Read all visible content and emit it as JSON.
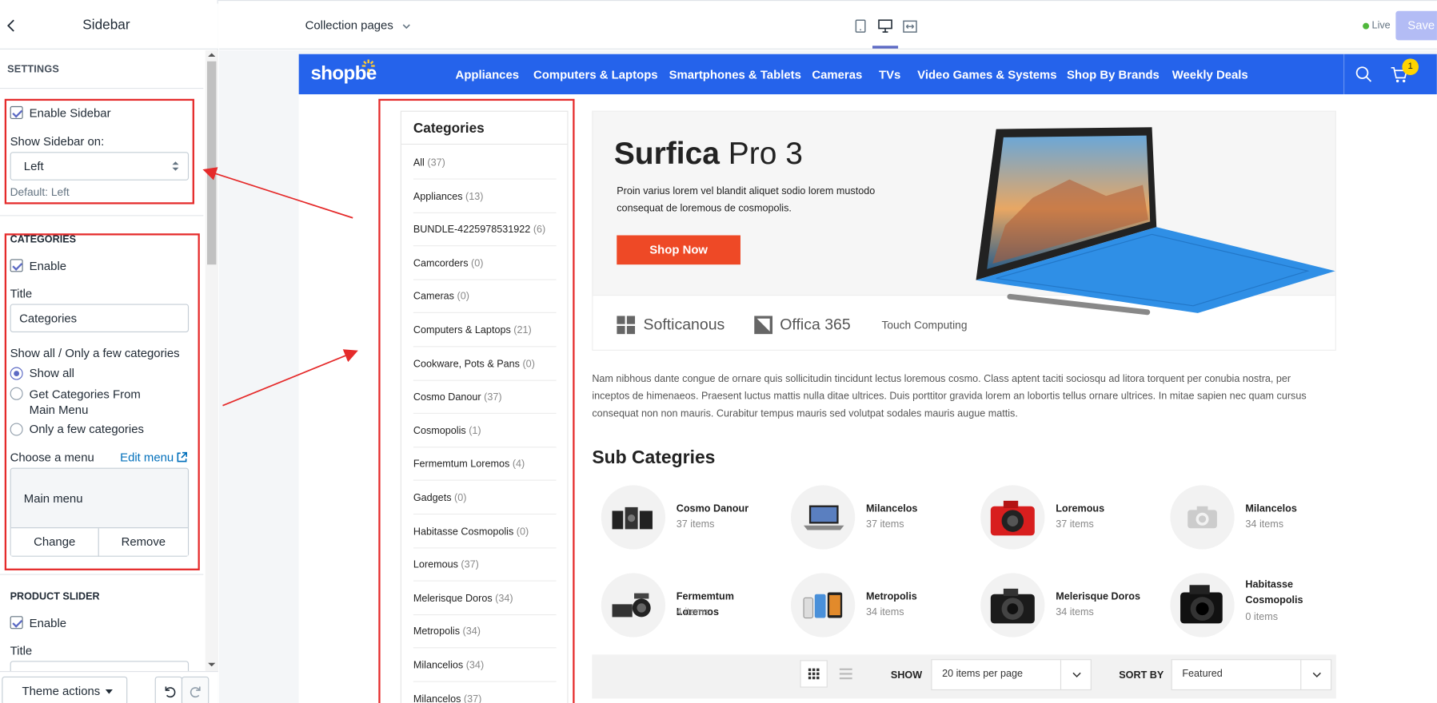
{
  "sidebar": {
    "title": "Sidebar",
    "settings_heading": "SETTINGS",
    "enable_sidebar_label": "Enable Sidebar",
    "show_on_label": "Show Sidebar on:",
    "show_on_value": "Left",
    "show_on_default": "Default: Left",
    "categories_heading": "CATEGORIES",
    "cat_enable_label": "Enable",
    "title_label": "Title",
    "title_value": "Categories",
    "show_mode_label": "Show all / Only a few categories",
    "radio_options": [
      "Show all",
      "Get Categories From Main Menu",
      "Only a few categories"
    ],
    "radio_selected": "Show all",
    "choose_menu_label": "Choose a menu",
    "edit_menu_label": "Edit menu",
    "menu_name": "Main menu",
    "change_label": "Change",
    "remove_label": "Remove",
    "slider_heading": "PRODUCT SLIDER",
    "slider_enable_label": "Enable",
    "slider_title_label": "Title",
    "theme_actions_label": "Theme actions"
  },
  "topbar": {
    "page_select": "Collection pages",
    "live_label": "Live",
    "save_label": "Save"
  },
  "store": {
    "logo": "shopbe",
    "nav": [
      "Appliances",
      "Computers & Laptops",
      "Smartphones & Tablets",
      "Cameras",
      "TVs",
      "Video Games & Systems",
      "Shop By Brands",
      "Weekly Deals"
    ],
    "cart_count": "1",
    "categories_title": "Categories",
    "categories": [
      {
        "name": "All",
        "count": "(37)"
      },
      {
        "name": "Appliances",
        "count": "(13)"
      },
      {
        "name": "BUNDLE-4225978531922",
        "count": "(6)"
      },
      {
        "name": "Camcorders",
        "count": "(0)"
      },
      {
        "name": "Cameras",
        "count": "(0)"
      },
      {
        "name": "Computers & Laptops",
        "count": "(21)"
      },
      {
        "name": "Cookware, Pots & Pans",
        "count": "(0)"
      },
      {
        "name": "Cosmo Danour",
        "count": "(37)"
      },
      {
        "name": "Cosmopolis",
        "count": "(1)"
      },
      {
        "name": "Fermemtum Loremos",
        "count": "(4)"
      },
      {
        "name": "Gadgets",
        "count": "(0)"
      },
      {
        "name": "Habitasse Cosmopolis",
        "count": "(0)"
      },
      {
        "name": "Loremous",
        "count": "(37)"
      },
      {
        "name": "Melerisque Doros",
        "count": "(34)"
      },
      {
        "name": "Metropolis",
        "count": "(34)"
      },
      {
        "name": "Milancelios",
        "count": "(34)"
      },
      {
        "name": "Milancelos",
        "count": "(37)"
      }
    ],
    "banner": {
      "title_bold": "Surfica",
      "title_light": " Pro 3",
      "text_line1": "Proin varius lorem vel blandit aliquet sodio lorem mustodo",
      "text_line2": "consequat de loremous de cosmopolis.",
      "cta": "Shop Now",
      "brands": [
        "Softicanous",
        "Offica 365",
        "Touch Computing"
      ]
    },
    "description": "Nam nibhous dante congue de ornare quis sollicitudin tincidunt lectus loremous cosmo. Class aptent taciti sociosqu ad litora torquent per conubia nostra, per inceptos de himenaeos. Praesent luctus mattis nulla ditae ultrices. Duis porttitor gravida lorem an lobortis tellus ornare ultrices. In mitae sapien nec quam cursus consequat non non mauris. Curabitur tempus mauris sed volutpat sodales mauris augue mattis.",
    "sub_heading": "Sub Categries",
    "sub_categories": [
      {
        "name": "Cosmo Danour",
        "items": "37 items",
        "icon": "speakers-icon"
      },
      {
        "name": "Milancelos",
        "items": "37 items",
        "icon": "laptop-icon"
      },
      {
        "name": "Loremous",
        "items": "37 items",
        "icon": "red-camera-icon"
      },
      {
        "name": "Milancelos",
        "items": "34 items",
        "icon": "camera-placeholder-icon"
      },
      {
        "name": "Fermemtum Loremos",
        "items": "4 items",
        "icon": "camera-kit-icon"
      },
      {
        "name": "Metropolis",
        "items": "34 items",
        "icon": "phones-icon"
      },
      {
        "name": "Melerisque Doros",
        "items": "34 items",
        "icon": "dslr-camera-icon"
      },
      {
        "name": "Habitasse Cosmopolis",
        "items": "0 items",
        "icon": "pro-camera-icon"
      }
    ],
    "toolbar": {
      "show_label": "SHOW",
      "per_page": "20 items per page",
      "sort_label": "SORT BY",
      "sort_value": "Featured"
    }
  },
  "colors": {
    "nav_bg": "#2563eb",
    "cta": "#ee4926",
    "highlight_box": "#e52b2b",
    "accent": "#5c6ac4"
  }
}
